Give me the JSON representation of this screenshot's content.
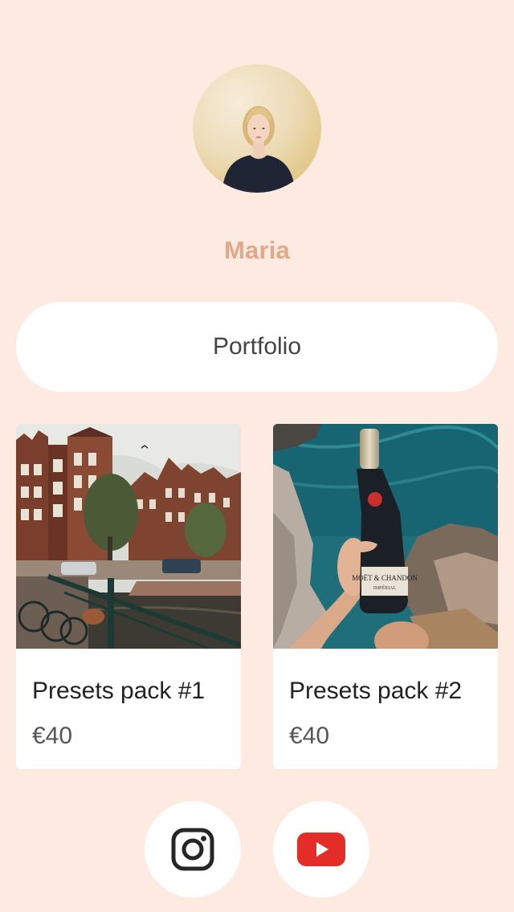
{
  "profile": {
    "name": "Maria",
    "avatar_icon": "profile-photo"
  },
  "links": [
    {
      "label": "Portfolio"
    }
  ],
  "products": [
    {
      "title": "Presets pack #1",
      "price": "€40",
      "image": "amsterdam-canal-houses-photo"
    },
    {
      "title": "Presets pack #2",
      "price": "€40",
      "image": "champagne-bottle-sea-photo"
    }
  ],
  "social": [
    {
      "name": "Instagram",
      "icon": "instagram-icon",
      "color": "#262626"
    },
    {
      "name": "YouTube",
      "icon": "youtube-icon",
      "color": "#e52d27"
    }
  ],
  "colors": {
    "background": "#fdebe2",
    "accent": "#e3a887",
    "card": "#ffffff"
  }
}
